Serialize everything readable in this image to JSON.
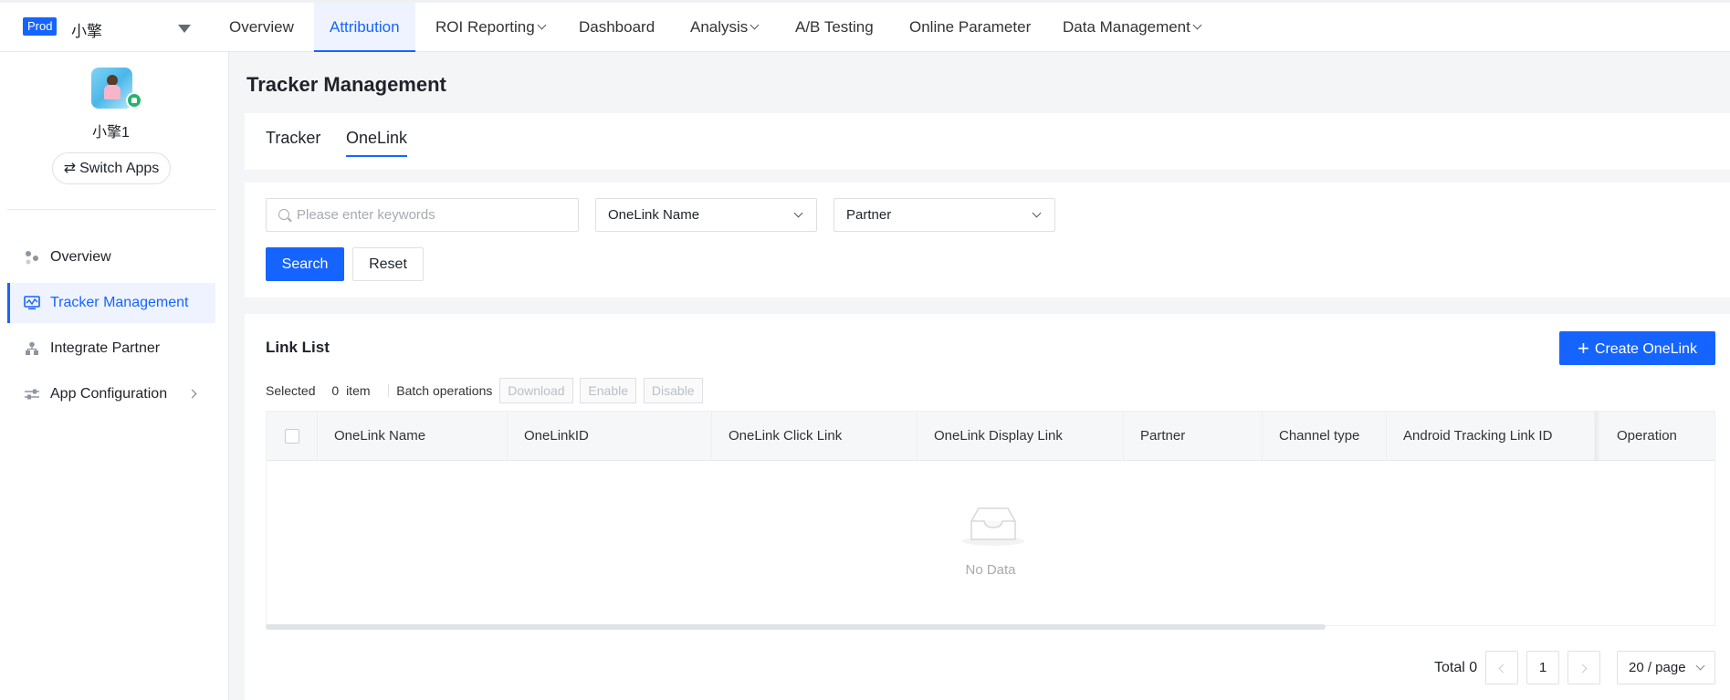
{
  "topnav": {
    "env": "Prod",
    "app_name": "小擎",
    "items": [
      {
        "label": "Overview",
        "dropdown": false,
        "active": false
      },
      {
        "label": "Attribution",
        "dropdown": false,
        "active": true
      },
      {
        "label": "ROI Reporting",
        "dropdown": true,
        "active": false
      },
      {
        "label": "Dashboard",
        "dropdown": false,
        "active": false
      },
      {
        "label": "Analysis",
        "dropdown": true,
        "active": false
      },
      {
        "label": "A/B Testing",
        "dropdown": false,
        "active": false
      },
      {
        "label": "Online Parameter",
        "dropdown": false,
        "active": false
      },
      {
        "label": "Data Management",
        "dropdown": true,
        "active": false
      }
    ]
  },
  "sidebar": {
    "user_name": "小擎1",
    "switch_label": "Switch Apps",
    "items": [
      {
        "label": "Overview",
        "icon": "overview-icon",
        "active": false
      },
      {
        "label": "Tracker Management",
        "icon": "tracker-monitor-icon",
        "active": true
      },
      {
        "label": "Integrate Partner",
        "icon": "partner-network-icon",
        "active": false
      },
      {
        "label": "App Configuration",
        "icon": "sliders-icon",
        "active": false,
        "expandable": true
      }
    ]
  },
  "page": {
    "title": "Tracker Management",
    "tabs": [
      {
        "label": "Tracker",
        "active": false
      },
      {
        "label": "OneLink",
        "active": true
      }
    ]
  },
  "filters": {
    "keyword_placeholder": "Please enter keywords",
    "select1_value": "OneLink Name",
    "select2_value": "Partner",
    "search_label": "Search",
    "reset_label": "Reset"
  },
  "list": {
    "title": "Link List",
    "create_label": "Create OneLink",
    "selected_prefix": "Selected",
    "selected_count": "0",
    "selected_suffix": "item",
    "batch_label": "Batch operations",
    "batch_buttons": [
      "Download",
      "Enable",
      "Disable"
    ],
    "columns": [
      "OneLink Name",
      "OneLinkID",
      "OneLink Click Link",
      "OneLink Display Link",
      "Partner",
      "Channel type",
      "Android Tracking Link ID",
      "Operation"
    ],
    "rows": [],
    "empty_text": "No Data"
  },
  "pagination": {
    "total_label": "Total 0",
    "current_page": "1",
    "page_size": "20 / page"
  },
  "colors": {
    "accent": "#1664ff",
    "active_bg": "#eef3ff"
  }
}
